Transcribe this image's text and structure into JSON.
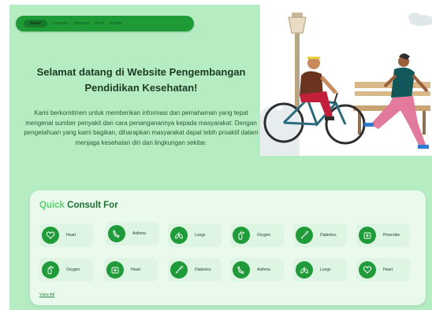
{
  "nav": {
    "items": [
      "Home",
      "Layanan",
      "Informasi",
      "Profil",
      "Kontak"
    ]
  },
  "hero": {
    "title": "Selamat datang di Website Pengembangan Pendidikan Kesehatan!",
    "description": "Kami berkomitmen untuk memberikan informasi dan pemahaman yang tepat mengenai sumber penyakit dan cara penanganannya kepada masyarakat. Dengan pengetahuan yang kami bagikan, diharapkan masyarakat dapat lebih proaktif dalam menjaga kesehatan diri dan lingkungan sekitar."
  },
  "consult": {
    "title_accent": "Quick",
    "title_rest": " Consult For",
    "items": [
      {
        "label": "Heart",
        "icon": "heart-icon"
      },
      {
        "label": "Asthma",
        "icon": "asthma-icon"
      },
      {
        "label": "Lungs",
        "icon": "lungs-icon"
      },
      {
        "label": "Oxygen",
        "icon": "oxygen-icon"
      },
      {
        "label": "Diabetics",
        "icon": "syringe-icon"
      },
      {
        "label": "Prescribe",
        "icon": "medkit-icon"
      },
      {
        "label": "Oxygen",
        "icon": "oxygen-icon"
      },
      {
        "label": "Heart",
        "icon": "medkit-icon"
      },
      {
        "label": "Diabetics",
        "icon": "syringe-icon"
      },
      {
        "label": "Asthma",
        "icon": "asthma-icon"
      },
      {
        "label": "Lungs",
        "icon": "lungs-icon"
      },
      {
        "label": "Heart",
        "icon": "heart-icon"
      }
    ],
    "view_all": "View All"
  },
  "colors": {
    "page_bg": "#b5ecc2",
    "nav_bg": "#1e9b36",
    "icon_bg": "#1f9b3a",
    "card_bg": "#e9faed",
    "accent": "#57d46e"
  }
}
